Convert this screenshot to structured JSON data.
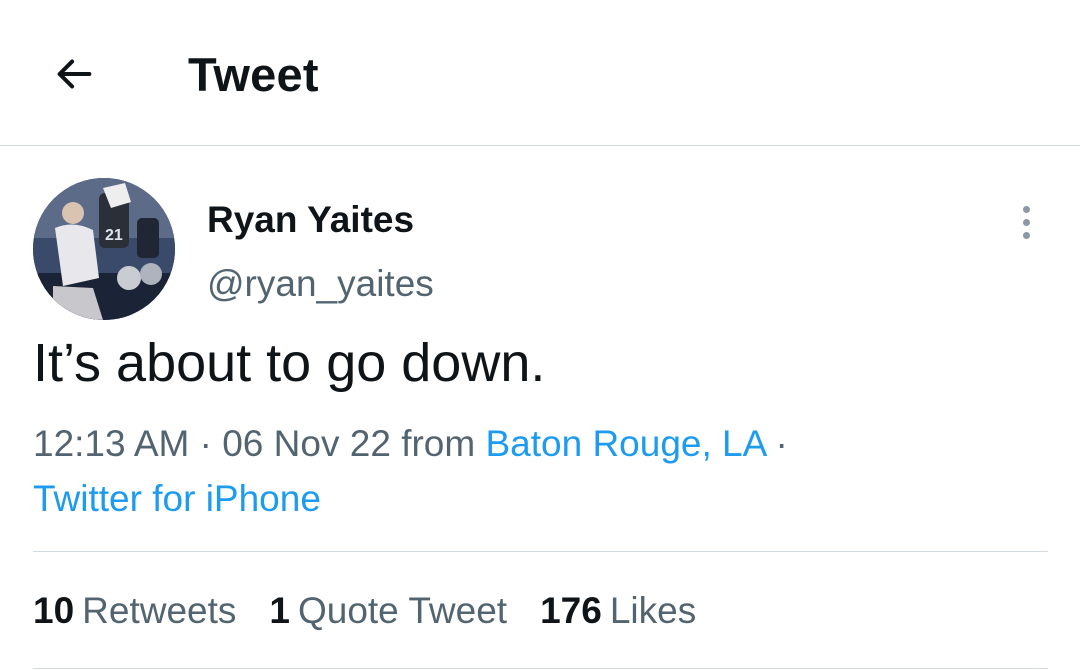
{
  "header": {
    "title": "Tweet",
    "back_icon": "arrow-left-icon"
  },
  "tweet": {
    "author": {
      "display_name": "Ryan Yaites",
      "handle": "@ryan_yaites",
      "avatar_icon": "profile-photo"
    },
    "more_icon": "more-vertical-icon",
    "text": "It’s about to go down.",
    "time": "12:13 AM",
    "separator": "·",
    "date": "06 Nov 22",
    "from_label": "from",
    "location": "Baton Rouge, LA",
    "source": "Twitter for iPhone",
    "stats": {
      "retweets_count": "10",
      "retweets_label": "Retweets",
      "quotes_count": "1",
      "quotes_label": "Quote Tweet",
      "likes_count": "176",
      "likes_label": "Likes"
    }
  },
  "colors": {
    "link": "#1d9bf0",
    "secondary_text": "#536471",
    "primary_text": "#0f1419",
    "divider": "#cfd9de"
  }
}
